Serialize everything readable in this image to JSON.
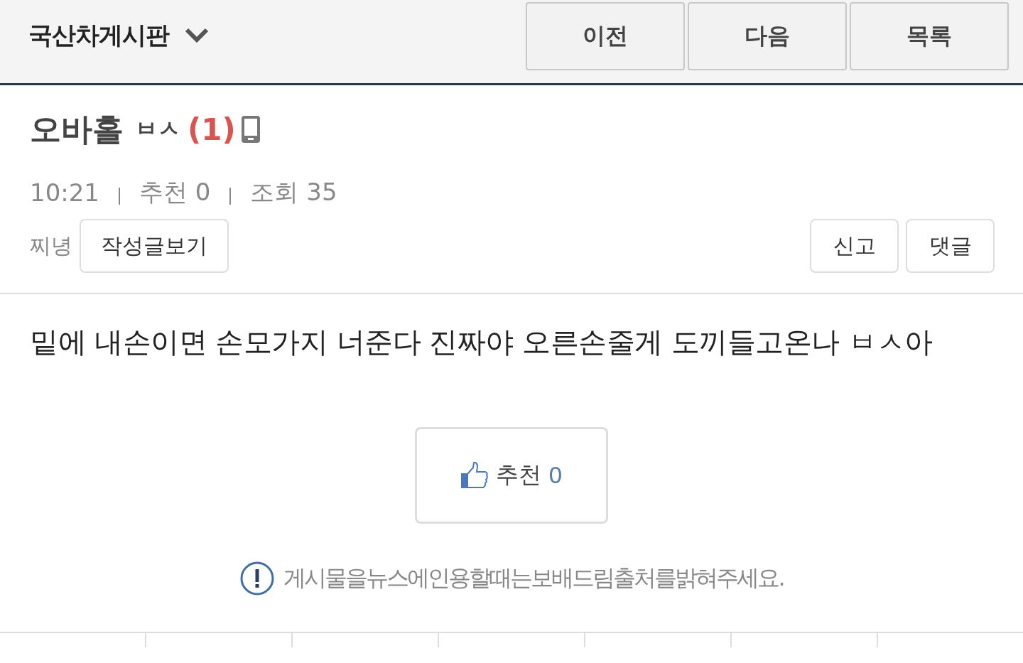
{
  "header": {
    "board_title": "국산차게시판",
    "nav_buttons": [
      "이전",
      "다음",
      "목록"
    ]
  },
  "post": {
    "title": "오바홀",
    "title_suffix": "ㅂㅅ",
    "comment_count": "(1)",
    "mobile": true,
    "meta": [
      "10:21",
      "추천 0",
      "조회 35"
    ],
    "author": "찌녕",
    "author_button": "작성글보기",
    "actions": [
      "신고",
      "댓글"
    ],
    "body": "밑에 내손이면 손모가지 너준다 진짜야 오른손줄게 도끼들고온나 ㅂㅅ아",
    "recommend": {
      "label": "추천",
      "count": "0"
    },
    "notice": "게시물을뉴스에인용할때는보배드림출처를밝혀주세요."
  }
}
